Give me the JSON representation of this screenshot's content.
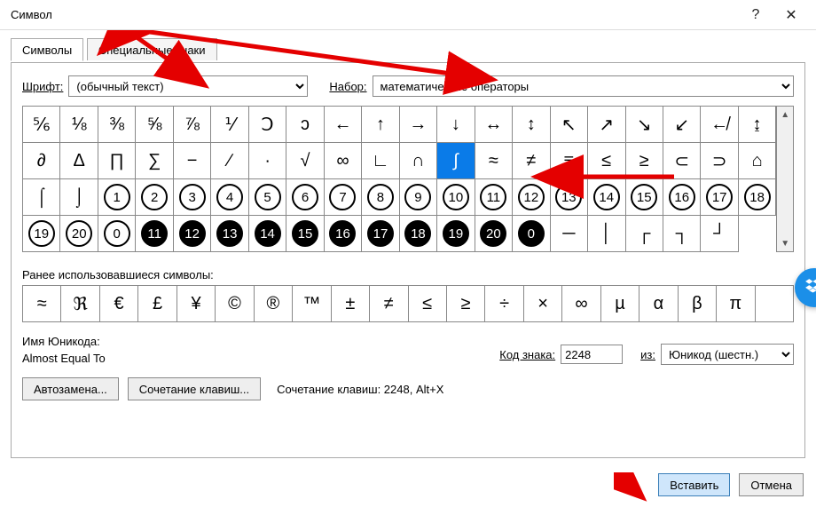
{
  "window": {
    "title": "Символ"
  },
  "tabs": [
    {
      "id": "symbols",
      "label": "Символы",
      "active": true
    },
    {
      "id": "special",
      "label": "Специальные знаки",
      "active": false
    }
  ],
  "fontRow": {
    "fontLabel": "Шрифт:",
    "fontValue": "(обычный текст)",
    "setLabel": "Набор:",
    "setValue": "математические операторы"
  },
  "grid": {
    "selectedIndex": 31,
    "cells": [
      "⅚",
      "⅛",
      "⅜",
      "⅝",
      "⅞",
      "⅟",
      "Ↄ",
      "ↄ",
      "←",
      "↑",
      "→",
      "↓",
      "↔",
      "↕",
      "↖",
      "↗",
      "↘",
      "↙",
      "↚",
      "↨",
      "∂",
      "Δ",
      "∏",
      "∑",
      "−",
      "∕",
      "∙",
      "√",
      "∞",
      "∟",
      "∩",
      "∫",
      "≈",
      "≠",
      "≡",
      "≤",
      "≥",
      "⊂",
      "⊃",
      "⌂",
      "⌠",
      "⌡",
      "①",
      "②",
      "③",
      "④",
      "⑤",
      "⑥",
      "⑦",
      "⑧",
      "⑨",
      "⑩",
      "⑪",
      "⑫",
      "⑬",
      "⑭",
      "⑮",
      "⑯",
      "⑰",
      "⑱",
      "⑲",
      "⑳",
      "⓪",
      "⓫",
      "⓬",
      "⓭",
      "⓮",
      "⓯",
      "⓰",
      "⓱",
      "⓲",
      "⓳",
      "⓴",
      "⓿",
      "─",
      "│",
      "┌",
      "┐",
      "┘"
    ]
  },
  "recent": {
    "label": "Ранее использовавшиеся символы:",
    "cells": [
      "≈",
      "ℜ",
      "€",
      "£",
      "¥",
      "©",
      "®",
      "™",
      "±",
      "≠",
      "≤",
      "≥",
      "÷",
      "×",
      "∞",
      "µ",
      "α",
      "β",
      "π"
    ]
  },
  "unicode": {
    "nameLabel": "Имя Юникода:",
    "nameValue": "Almost Equal To",
    "codeLabel": "Код знака:",
    "codeValue": "2248",
    "fromLabel": "из:",
    "fromValue": "Юникод (шестн.)"
  },
  "buttons": {
    "autocorrect": "Автозамена...",
    "shortcut": "Сочетание клавиш...",
    "shortcutInfo": "Сочетание клавиш: 2248, Alt+X",
    "insert": "Вставить",
    "cancel": "Отмена"
  },
  "annotations": {
    "arrowColor": "#e40000"
  }
}
